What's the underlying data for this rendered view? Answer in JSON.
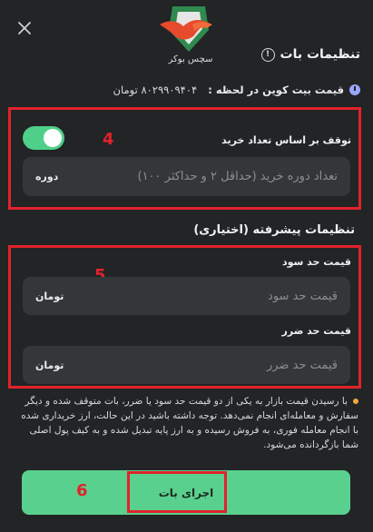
{
  "header": {
    "title": "تنظیمات بات",
    "logo_text": "سچس بوکر",
    "close_icon": "close-icon",
    "info_icon": "info-icon"
  },
  "price": {
    "label": "قیمت بیت کوین در لحظه :",
    "value": "۸۰۲۹۹۰۹۴۰۴ تومان",
    "icon": "clock-icon"
  },
  "stop_section": {
    "step_number": "4",
    "label": "توقف بر اساس تعداد خرید",
    "toggle_on": true,
    "input_placeholder": "تعداد دوره خرید (حداقل ۲ و حداکثر ۱۰۰)",
    "input_unit": "دوره"
  },
  "advanced": {
    "title": "تنظیمات پیشرفته (اختیاری)",
    "step_number": "5",
    "take_profit": {
      "label": "قیمت حد سود",
      "placeholder": "قیمت حد سود",
      "unit": "تومان"
    },
    "stop_loss": {
      "label": "قیمت حد ضرر",
      "placeholder": "قیمت حد ضرر",
      "unit": "تومان"
    }
  },
  "note": "با رسیدن قیمت بازار به یکی از دو قیمت حد سود یا ضرر، بات متوقف شده و دیگر سفارش و معامله‌ای انجام نمی‌دهد. توجه داشته باشید در این حالت، ارز خریداری شده با انجام معامله فوری، به فروش رسیده و به ارز پایه تبدیل شده و به کیف پول اصلی شما بازگردانده می‌شود.",
  "run_button": {
    "label": "اجرای بات",
    "step_number": "6"
  },
  "colors": {
    "accent_green": "#5ad08f",
    "highlight_red": "#e1222b",
    "bullet_orange": "#f3a93b"
  }
}
